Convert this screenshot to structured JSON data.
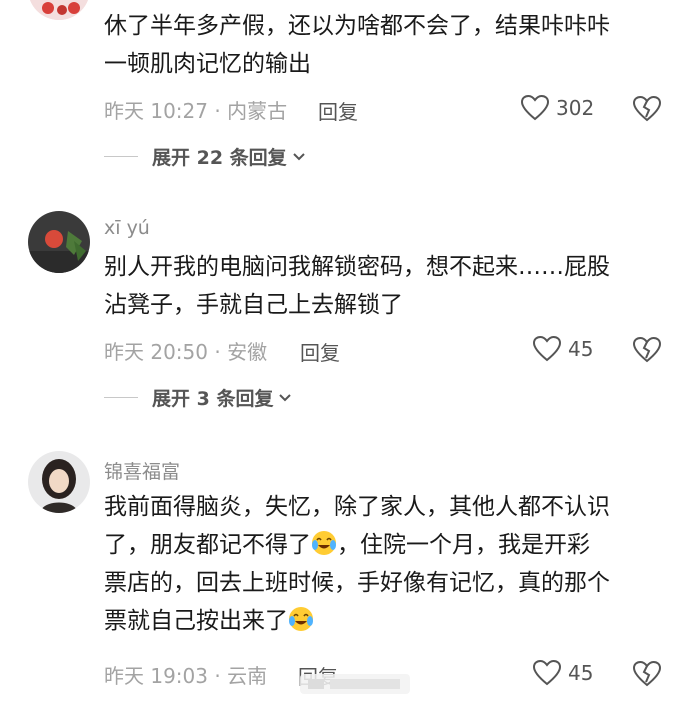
{
  "comments": [
    {
      "text_line1": "休了半年多产假，还以为啥都不会了，结果咔咔咔",
      "text_line2": "一顿肌肉记忆的输出",
      "time": "昨天 10:27 · 内蒙古",
      "reply": "回复",
      "likes": "302",
      "expand": "展开 22 条回复"
    },
    {
      "username": "xī yú",
      "text_line1": "别人开我的电脑问我解锁密码，想不起来……屁股",
      "text_line2": "沾凳子，手就自己上去解锁了",
      "time": "昨天 20:50 · 安徽",
      "reply": "回复",
      "likes": "45",
      "expand": "展开 3 条回复"
    },
    {
      "username": "锦喜福富",
      "text_line1": "我前面得脑炎，失忆，除了家人，其他人都不认识",
      "text_line2a": "了，朋友都记不得了",
      "text_line2b": "，住院一个月，我是开彩",
      "text_line3": "票店的，回去上班时候，手好像有记忆，真的那个",
      "text_line4": "票就自己按出来了",
      "time": "昨天 19:03 · 云南",
      "reply": "回复",
      "likes": "45"
    }
  ],
  "icons": {
    "like": "heart-outline-icon",
    "dislike": "broken-heart-icon",
    "expand": "chevron-down-icon",
    "emoji": "crying-laughing-emoji"
  }
}
